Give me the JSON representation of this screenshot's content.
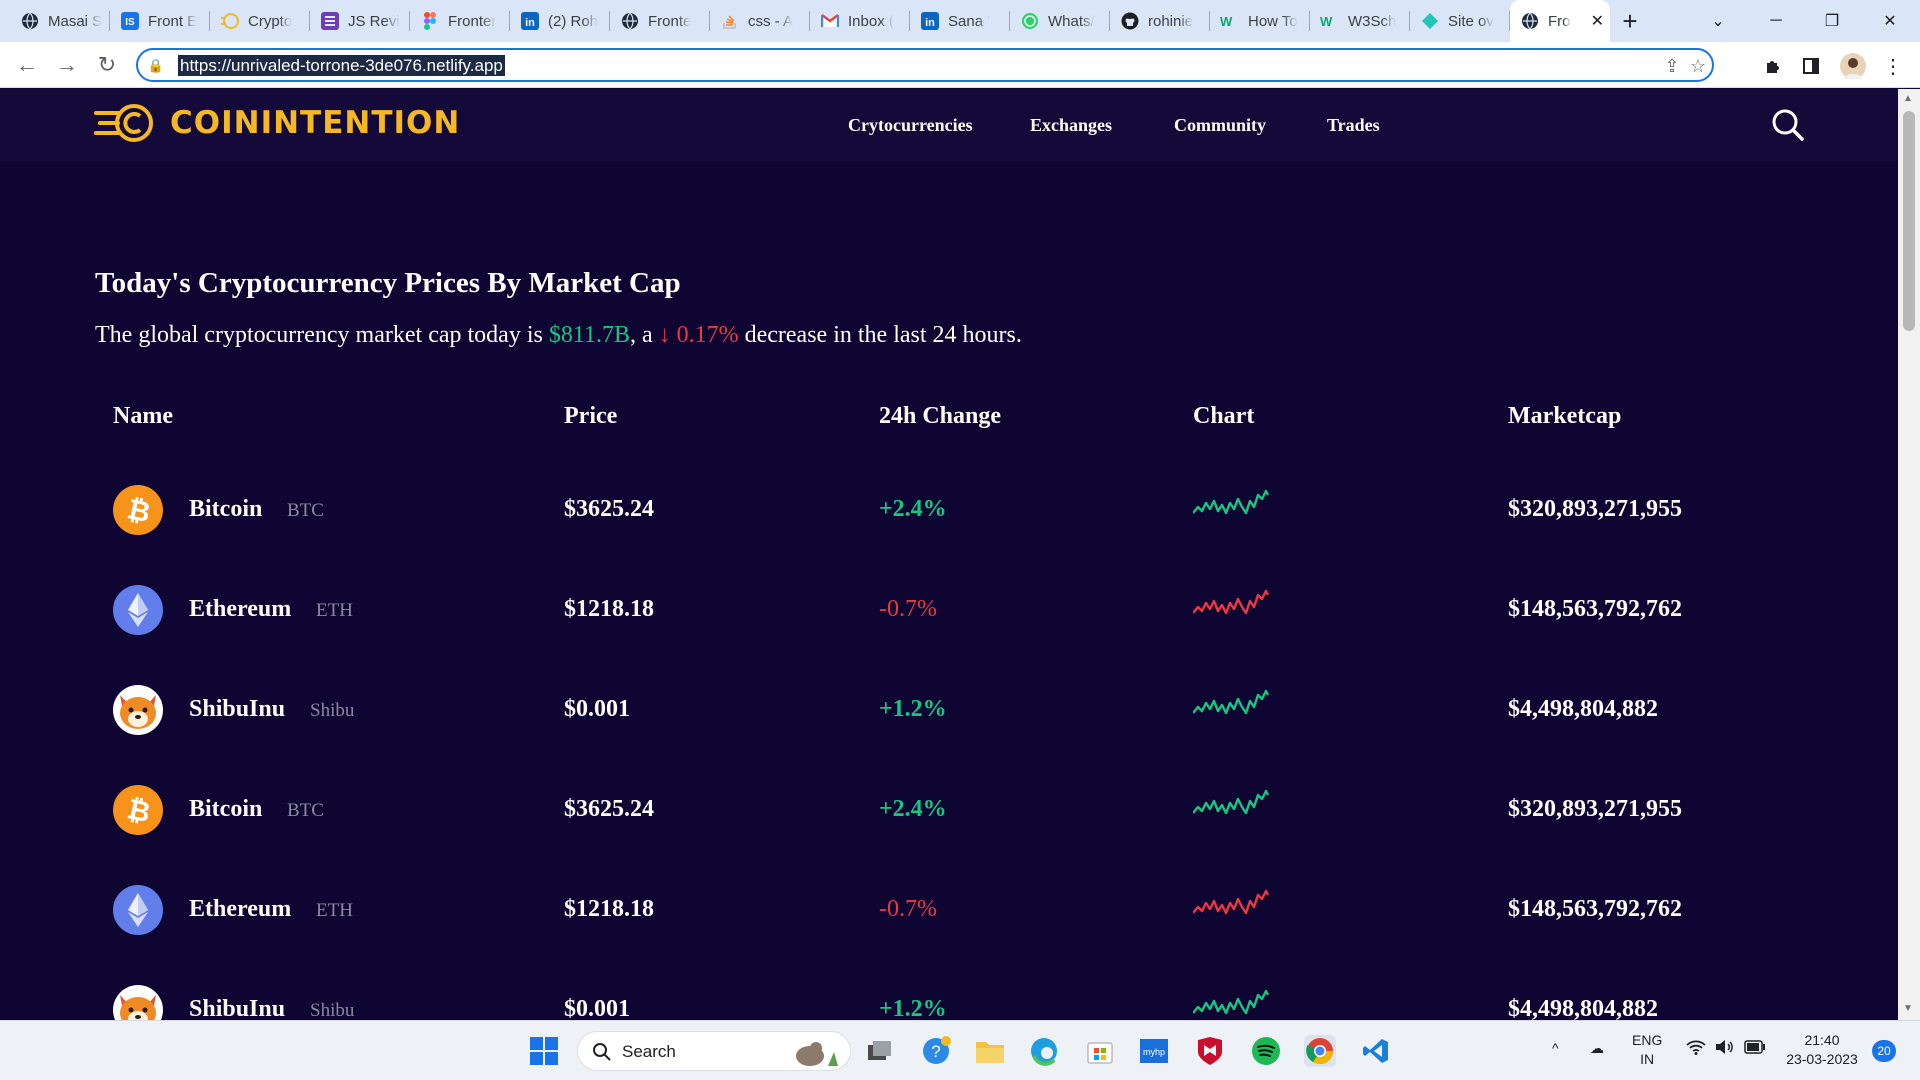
{
  "browser": {
    "tabs": [
      {
        "title": "Masai S",
        "icon": "globe-icon"
      },
      {
        "title": "Front E",
        "icon": "is-icon"
      },
      {
        "title": "Crypto",
        "icon": "coin-logo-icon"
      },
      {
        "title": "JS Revi",
        "icon": "list-icon"
      },
      {
        "title": "Fronter",
        "icon": "figma-icon"
      },
      {
        "title": "(2) Roh",
        "icon": "linkedin-icon"
      },
      {
        "title": "Fronte",
        "icon": "globe-icon"
      },
      {
        "title": "css - A",
        "icon": "stack-icon"
      },
      {
        "title": "Inbox (",
        "icon": "gmail-icon"
      },
      {
        "title": "Sana '",
        "icon": "linkedin-icon"
      },
      {
        "title": "Whats/",
        "icon": "whatsapp-icon"
      },
      {
        "title": "rohinie",
        "icon": "github-icon"
      },
      {
        "title": "How To",
        "icon": "w3-icon"
      },
      {
        "title": "W3Sch",
        "icon": "w3-icon"
      },
      {
        "title": "Site ov",
        "icon": "netlify-icon"
      },
      {
        "title": "Fro",
        "icon": "globe-icon",
        "active": true
      }
    ],
    "new_tab": "+",
    "close_tab": "✕",
    "url": "https://unrivaled-torrone-3de076.netlify.app"
  },
  "site": {
    "logo_text": "COININTENTION",
    "nav": [
      "Crytocurrencies",
      "Exchanges",
      "Community",
      "Trades"
    ],
    "heading": "Today's Cryptocurrency Prices By Market Cap",
    "summary": {
      "prefix": "The global cryptocurrency market cap today is ",
      "market_cap": "$811.7B",
      "middle": ", a ",
      "arrow": "↓",
      "change": " 0.17%",
      "suffix": " decrease in the last 24 hours."
    },
    "columns": [
      "Name",
      "Price",
      "24h Change",
      "Chart",
      "Marketcap"
    ],
    "rows": [
      {
        "name": "Bitcoin",
        "symbol": "BTC",
        "price": "$3625.24",
        "change": "+2.4%",
        "trend": "up",
        "marketcap": "$320,893,271,955",
        "icon": "bitcoin-icon"
      },
      {
        "name": "Ethereum",
        "symbol": "ETH",
        "price": "$1218.18",
        "change": "-0.7%",
        "trend": "down",
        "marketcap": "$148,563,792,762",
        "icon": "ethereum-icon"
      },
      {
        "name": "ShibuInu",
        "symbol": "Shibu",
        "price": "$0.001",
        "change": "+1.2%",
        "trend": "up",
        "marketcap": "$4,498,804,882",
        "icon": "shiba-icon"
      },
      {
        "name": "Bitcoin",
        "symbol": "BTC",
        "price": "$3625.24",
        "change": "+2.4%",
        "trend": "up",
        "marketcap": "$320,893,271,955",
        "icon": "bitcoin-icon"
      },
      {
        "name": "Ethereum",
        "symbol": "ETH",
        "price": "$1218.18",
        "change": "-0.7%",
        "trend": "down",
        "marketcap": "$148,563,792,762",
        "icon": "ethereum-icon"
      },
      {
        "name": "ShibuInu",
        "symbol": "Shibu",
        "price": "$0.001",
        "change": "+1.2%",
        "trend": "up",
        "marketcap": "$4,498,804,882",
        "icon": "shiba-icon"
      }
    ],
    "colors": {
      "background": "#0f0532",
      "header": "#140a3a",
      "logo": "#f5b823",
      "up": "#16c784",
      "down": "#ea3943"
    }
  },
  "taskbar": {
    "search_label": "Search",
    "language": "ENG",
    "region": "IN",
    "time": "21:40",
    "date": "23-03-2023",
    "notification_count": "20"
  }
}
